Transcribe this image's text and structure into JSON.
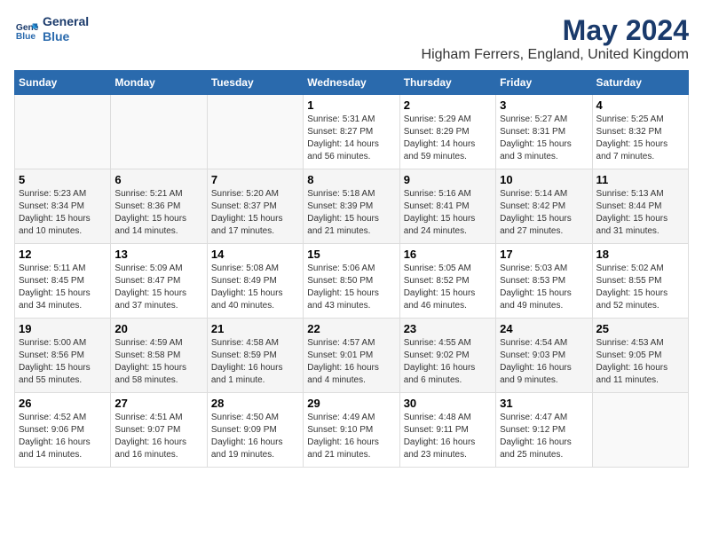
{
  "header": {
    "logo_line1": "General",
    "logo_line2": "Blue",
    "month": "May 2024",
    "location": "Higham Ferrers, England, United Kingdom"
  },
  "weekdays": [
    "Sunday",
    "Monday",
    "Tuesday",
    "Wednesday",
    "Thursday",
    "Friday",
    "Saturday"
  ],
  "weeks": [
    [
      {
        "day": "",
        "info": ""
      },
      {
        "day": "",
        "info": ""
      },
      {
        "day": "",
        "info": ""
      },
      {
        "day": "1",
        "info": "Sunrise: 5:31 AM\nSunset: 8:27 PM\nDaylight: 14 hours\nand 56 minutes."
      },
      {
        "day": "2",
        "info": "Sunrise: 5:29 AM\nSunset: 8:29 PM\nDaylight: 14 hours\nand 59 minutes."
      },
      {
        "day": "3",
        "info": "Sunrise: 5:27 AM\nSunset: 8:31 PM\nDaylight: 15 hours\nand 3 minutes."
      },
      {
        "day": "4",
        "info": "Sunrise: 5:25 AM\nSunset: 8:32 PM\nDaylight: 15 hours\nand 7 minutes."
      }
    ],
    [
      {
        "day": "5",
        "info": "Sunrise: 5:23 AM\nSunset: 8:34 PM\nDaylight: 15 hours\nand 10 minutes."
      },
      {
        "day": "6",
        "info": "Sunrise: 5:21 AM\nSunset: 8:36 PM\nDaylight: 15 hours\nand 14 minutes."
      },
      {
        "day": "7",
        "info": "Sunrise: 5:20 AM\nSunset: 8:37 PM\nDaylight: 15 hours\nand 17 minutes."
      },
      {
        "day": "8",
        "info": "Sunrise: 5:18 AM\nSunset: 8:39 PM\nDaylight: 15 hours\nand 21 minutes."
      },
      {
        "day": "9",
        "info": "Sunrise: 5:16 AM\nSunset: 8:41 PM\nDaylight: 15 hours\nand 24 minutes."
      },
      {
        "day": "10",
        "info": "Sunrise: 5:14 AM\nSunset: 8:42 PM\nDaylight: 15 hours\nand 27 minutes."
      },
      {
        "day": "11",
        "info": "Sunrise: 5:13 AM\nSunset: 8:44 PM\nDaylight: 15 hours\nand 31 minutes."
      }
    ],
    [
      {
        "day": "12",
        "info": "Sunrise: 5:11 AM\nSunset: 8:45 PM\nDaylight: 15 hours\nand 34 minutes."
      },
      {
        "day": "13",
        "info": "Sunrise: 5:09 AM\nSunset: 8:47 PM\nDaylight: 15 hours\nand 37 minutes."
      },
      {
        "day": "14",
        "info": "Sunrise: 5:08 AM\nSunset: 8:49 PM\nDaylight: 15 hours\nand 40 minutes."
      },
      {
        "day": "15",
        "info": "Sunrise: 5:06 AM\nSunset: 8:50 PM\nDaylight: 15 hours\nand 43 minutes."
      },
      {
        "day": "16",
        "info": "Sunrise: 5:05 AM\nSunset: 8:52 PM\nDaylight: 15 hours\nand 46 minutes."
      },
      {
        "day": "17",
        "info": "Sunrise: 5:03 AM\nSunset: 8:53 PM\nDaylight: 15 hours\nand 49 minutes."
      },
      {
        "day": "18",
        "info": "Sunrise: 5:02 AM\nSunset: 8:55 PM\nDaylight: 15 hours\nand 52 minutes."
      }
    ],
    [
      {
        "day": "19",
        "info": "Sunrise: 5:00 AM\nSunset: 8:56 PM\nDaylight: 15 hours\nand 55 minutes."
      },
      {
        "day": "20",
        "info": "Sunrise: 4:59 AM\nSunset: 8:58 PM\nDaylight: 15 hours\nand 58 minutes."
      },
      {
        "day": "21",
        "info": "Sunrise: 4:58 AM\nSunset: 8:59 PM\nDaylight: 16 hours\nand 1 minute."
      },
      {
        "day": "22",
        "info": "Sunrise: 4:57 AM\nSunset: 9:01 PM\nDaylight: 16 hours\nand 4 minutes."
      },
      {
        "day": "23",
        "info": "Sunrise: 4:55 AM\nSunset: 9:02 PM\nDaylight: 16 hours\nand 6 minutes."
      },
      {
        "day": "24",
        "info": "Sunrise: 4:54 AM\nSunset: 9:03 PM\nDaylight: 16 hours\nand 9 minutes."
      },
      {
        "day": "25",
        "info": "Sunrise: 4:53 AM\nSunset: 9:05 PM\nDaylight: 16 hours\nand 11 minutes."
      }
    ],
    [
      {
        "day": "26",
        "info": "Sunrise: 4:52 AM\nSunset: 9:06 PM\nDaylight: 16 hours\nand 14 minutes."
      },
      {
        "day": "27",
        "info": "Sunrise: 4:51 AM\nSunset: 9:07 PM\nDaylight: 16 hours\nand 16 minutes."
      },
      {
        "day": "28",
        "info": "Sunrise: 4:50 AM\nSunset: 9:09 PM\nDaylight: 16 hours\nand 19 minutes."
      },
      {
        "day": "29",
        "info": "Sunrise: 4:49 AM\nSunset: 9:10 PM\nDaylight: 16 hours\nand 21 minutes."
      },
      {
        "day": "30",
        "info": "Sunrise: 4:48 AM\nSunset: 9:11 PM\nDaylight: 16 hours\nand 23 minutes."
      },
      {
        "day": "31",
        "info": "Sunrise: 4:47 AM\nSunset: 9:12 PM\nDaylight: 16 hours\nand 25 minutes."
      },
      {
        "day": "",
        "info": ""
      }
    ]
  ]
}
